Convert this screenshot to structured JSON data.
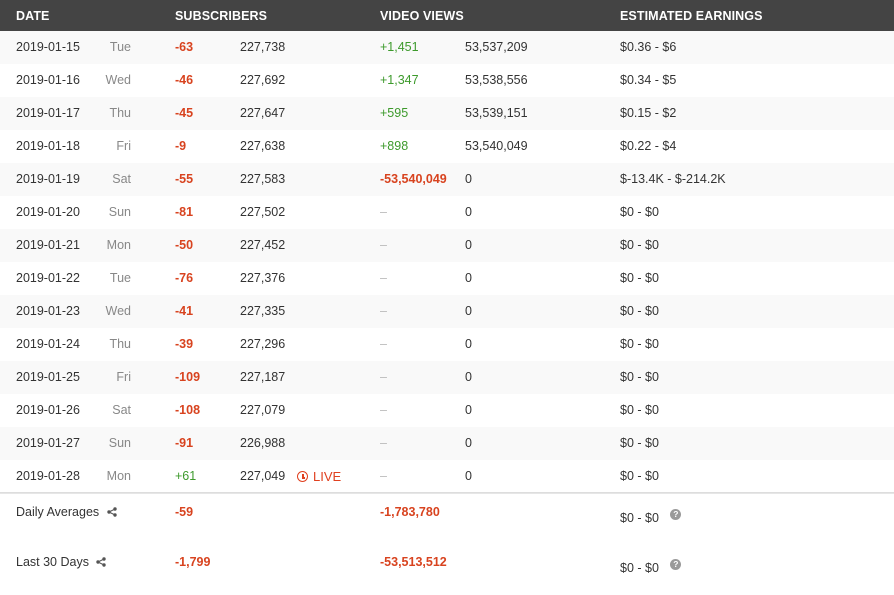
{
  "header": {
    "date": "DATE",
    "subscribers": "SUBSCRIBERS",
    "video_views": "VIDEO VIEWS",
    "earnings": "ESTIMATED EARNINGS"
  },
  "rows": [
    {
      "date": "2019-01-15",
      "day": "Tue",
      "sub_delta": "-63",
      "sub_total": "227,738",
      "view_delta": "+1,451",
      "view_total": "53,537,209",
      "earnings": "$0.36  -  $6"
    },
    {
      "date": "2019-01-16",
      "day": "Wed",
      "sub_delta": "-46",
      "sub_total": "227,692",
      "view_delta": "+1,347",
      "view_total": "53,538,556",
      "earnings": "$0.34  -  $5"
    },
    {
      "date": "2019-01-17",
      "day": "Thu",
      "sub_delta": "-45",
      "sub_total": "227,647",
      "view_delta": "+595",
      "view_total": "53,539,151",
      "earnings": "$0.15  -  $2"
    },
    {
      "date": "2019-01-18",
      "day": "Fri",
      "sub_delta": "-9",
      "sub_total": "227,638",
      "view_delta": "+898",
      "view_total": "53,540,049",
      "earnings": "$0.22  -  $4"
    },
    {
      "date": "2019-01-19",
      "day": "Sat",
      "sub_delta": "-55",
      "sub_total": "227,583",
      "view_delta": "-53,540,049",
      "view_total": "0",
      "earnings": "$-13.4K  -  $-214.2K"
    },
    {
      "date": "2019-01-20",
      "day": "Sun",
      "sub_delta": "-81",
      "sub_total": "227,502",
      "view_delta": "--",
      "view_total": "0",
      "earnings": "$0  -  $0"
    },
    {
      "date": "2019-01-21",
      "day": "Mon",
      "sub_delta": "-50",
      "sub_total": "227,452",
      "view_delta": "--",
      "view_total": "0",
      "earnings": "$0  -  $0"
    },
    {
      "date": "2019-01-22",
      "day": "Tue",
      "sub_delta": "-76",
      "sub_total": "227,376",
      "view_delta": "--",
      "view_total": "0",
      "earnings": "$0  -  $0"
    },
    {
      "date": "2019-01-23",
      "day": "Wed",
      "sub_delta": "-41",
      "sub_total": "227,335",
      "view_delta": "--",
      "view_total": "0",
      "earnings": "$0  -  $0"
    },
    {
      "date": "2019-01-24",
      "day": "Thu",
      "sub_delta": "-39",
      "sub_total": "227,296",
      "view_delta": "--",
      "view_total": "0",
      "earnings": "$0  -  $0"
    },
    {
      "date": "2019-01-25",
      "day": "Fri",
      "sub_delta": "-109",
      "sub_total": "227,187",
      "view_delta": "--",
      "view_total": "0",
      "earnings": "$0  -  $0"
    },
    {
      "date": "2019-01-26",
      "day": "Sat",
      "sub_delta": "-108",
      "sub_total": "227,079",
      "view_delta": "--",
      "view_total": "0",
      "earnings": "$0  -  $0"
    },
    {
      "date": "2019-01-27",
      "day": "Sun",
      "sub_delta": "-91",
      "sub_total": "226,988",
      "view_delta": "--",
      "view_total": "0",
      "earnings": "$0  -  $0"
    },
    {
      "date": "2019-01-28",
      "day": "Mon",
      "sub_delta": "+61",
      "sub_total": "227,049",
      "live": "LIVE",
      "view_delta": "--",
      "view_total": "0",
      "earnings": "$0  -  $0"
    }
  ],
  "summary": {
    "daily": {
      "label": "Daily Averages",
      "sub": "-59",
      "views": "-1,783,780",
      "earnings": "$0  -  $0"
    },
    "last30": {
      "label": "Last 30 Days",
      "sub": "-1,799",
      "views": "-53,513,512",
      "earnings": "$0  -  $0"
    }
  },
  "icons": {
    "share": "share-icon",
    "help": "help-icon",
    "live": "clock-icon"
  },
  "colors": {
    "negative": "#d8431f",
    "positive": "#3d9a2c",
    "header_bg": "#444444"
  }
}
